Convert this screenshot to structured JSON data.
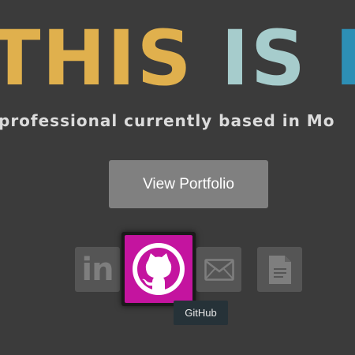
{
  "hero": {
    "word1": "THIS",
    "word2": "IS",
    "word3": "I"
  },
  "tagline": "professional currently based in Mo",
  "portfolio_button": "View Portfolio",
  "social": {
    "linkedin_label": "in",
    "icons": [
      "linkedin-icon",
      "github-icon",
      "email-icon",
      "document-icon"
    ]
  },
  "tooltip": "GitHub",
  "colors": {
    "background": "#3b3b3b",
    "accent_yellow": "#e0b04d",
    "accent_teal": "#a6cccc",
    "accent_blue": "#2d8fb5",
    "github_magenta": "#c4149f",
    "button_gray": "#808080"
  }
}
